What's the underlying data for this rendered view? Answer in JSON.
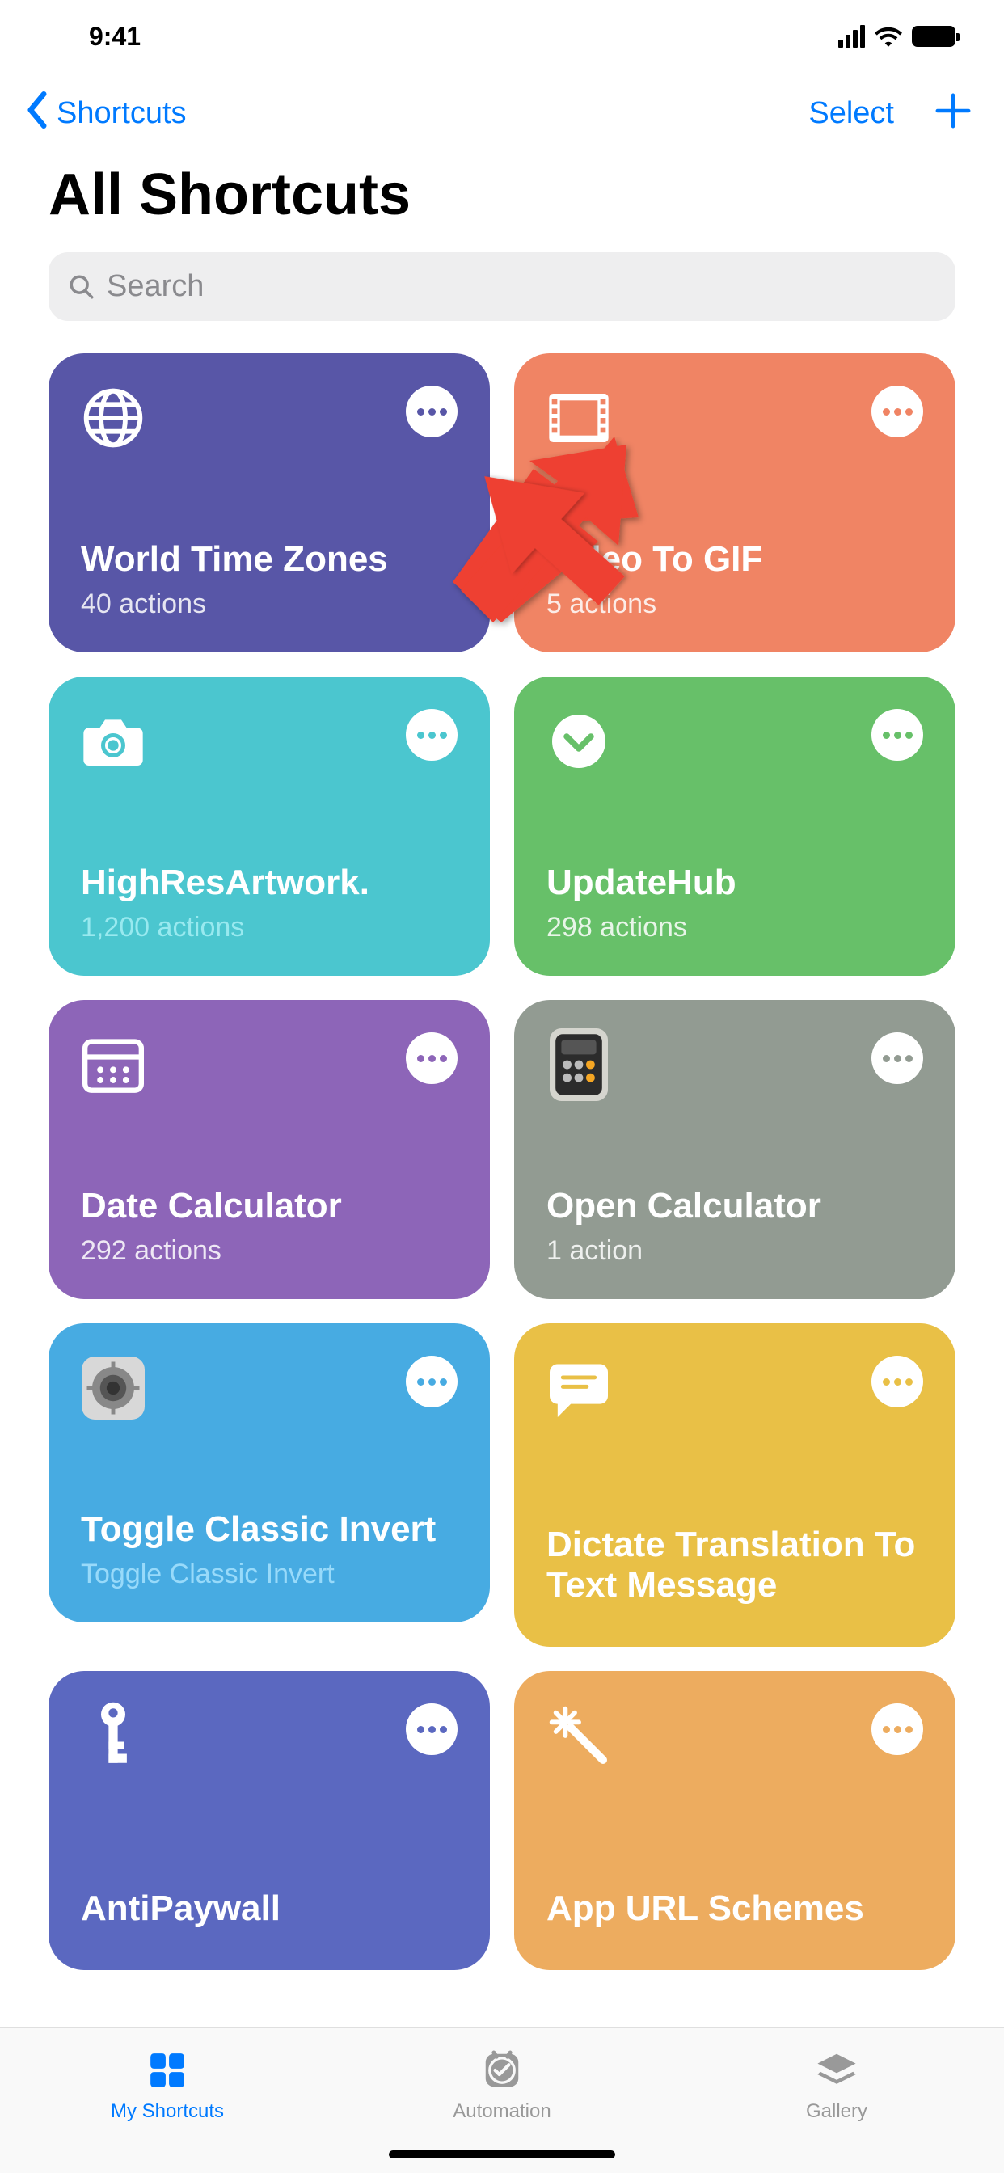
{
  "status": {
    "time": "9:41"
  },
  "nav": {
    "back_label": "Shortcuts",
    "select_label": "Select"
  },
  "header": {
    "title": "All Shortcuts"
  },
  "search": {
    "placeholder": "Search"
  },
  "shortcuts": [
    {
      "title": "World Time Zones",
      "sub": "40 actions",
      "icon": "globe-icon",
      "color": "#5856A7",
      "dot_color": "#5856A7",
      "class": "bg-indigo"
    },
    {
      "title": "Video To GIF",
      "sub": "5 actions",
      "icon": "film-icon",
      "color": "#F08464",
      "dot_color": "#F08464",
      "class": "bg-coral"
    },
    {
      "title": "HighResArtwork.",
      "sub": "1,200 actions",
      "icon": "camera-icon",
      "color": "#4BC6CF",
      "dot_color": "#4BC6CF",
      "class": "bg-teal"
    },
    {
      "title": "UpdateHub",
      "sub": "298 actions",
      "icon": "chevron-down-circle-icon",
      "color": "#67C069",
      "dot_color": "#67C069",
      "class": "bg-green"
    },
    {
      "title": "Date Calculator",
      "sub": "292 actions",
      "icon": "calendar-icon",
      "color": "#8D65B8",
      "dot_color": "#8D65B8",
      "class": "bg-purple"
    },
    {
      "title": "Open Calculator",
      "sub": "1 action",
      "icon": "calculator-app-icon",
      "color": "#929B92",
      "dot_color": "#929B92",
      "class": "bg-gray"
    },
    {
      "title": "Toggle Classic Invert",
      "sub": "Toggle Classic Invert",
      "icon": "settings-app-icon",
      "color": "#47ABE2",
      "dot_color": "#47ABE2",
      "class": "bg-sky"
    },
    {
      "title": "Dictate Transla­tion To Text Message",
      "sub": "",
      "icon": "speech-icon",
      "color": "#E9C046",
      "dot_color": "#E9C046",
      "class": "bg-gold"
    },
    {
      "title": "AntiPaywall",
      "sub": "",
      "icon": "key-icon",
      "color": "#5B68C0",
      "dot_color": "#5B68C0",
      "class": "bg-blue"
    },
    {
      "title": "App URL Schemes",
      "sub": "",
      "icon": "wand-icon",
      "color": "#EDAC5F",
      "dot_color": "#EDAC5F",
      "class": "bg-orange"
    }
  ],
  "tabs": {
    "my_shortcuts": "My Shortcuts",
    "automation": "Automation",
    "gallery": "Gallery"
  }
}
